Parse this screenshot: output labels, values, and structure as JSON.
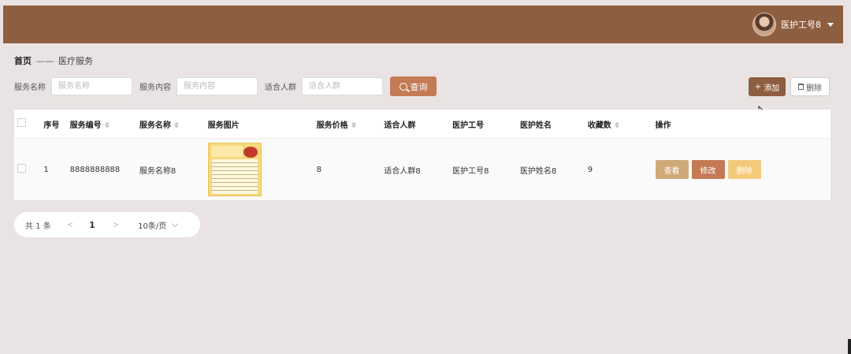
{
  "header": {
    "username": "医护工号8",
    "colors": {
      "bar": "#8e5e40"
    }
  },
  "breadcrumb": {
    "home": "首页",
    "separator": "——",
    "current": "医疗服务"
  },
  "search": {
    "name_label": "服务名称",
    "name_placeholder": "服务名称",
    "content_label": "服务内容",
    "content_placeholder": "服务内容",
    "crowd_label": "适合人群",
    "crowd_placeholder": "适合人群",
    "query_button": "查询"
  },
  "toolbar": {
    "add_button": "添加",
    "delete_button": "删除"
  },
  "table": {
    "columns": {
      "index": "序号",
      "code": "服务编号",
      "name": "服务名称",
      "image": "服务图片",
      "price": "服务价格",
      "crowd": "适合人群",
      "staff_id": "医护工号",
      "staff_name": "医护姓名",
      "favorites": "收藏数",
      "actions": "操作"
    },
    "rows": [
      {
        "index": "1",
        "code": "8888888888",
        "name": "服务名称8",
        "price": "8",
        "crowd": "适合人群8",
        "staff_id": "医护工号8",
        "staff_name": "医护姓名8",
        "favorites": "9",
        "view": "查看",
        "edit": "修改",
        "delete": "删除"
      }
    ]
  },
  "pagination": {
    "total": "共 1 条",
    "prev": "<",
    "page": "1",
    "next": ">",
    "page_size": "10条/页"
  }
}
